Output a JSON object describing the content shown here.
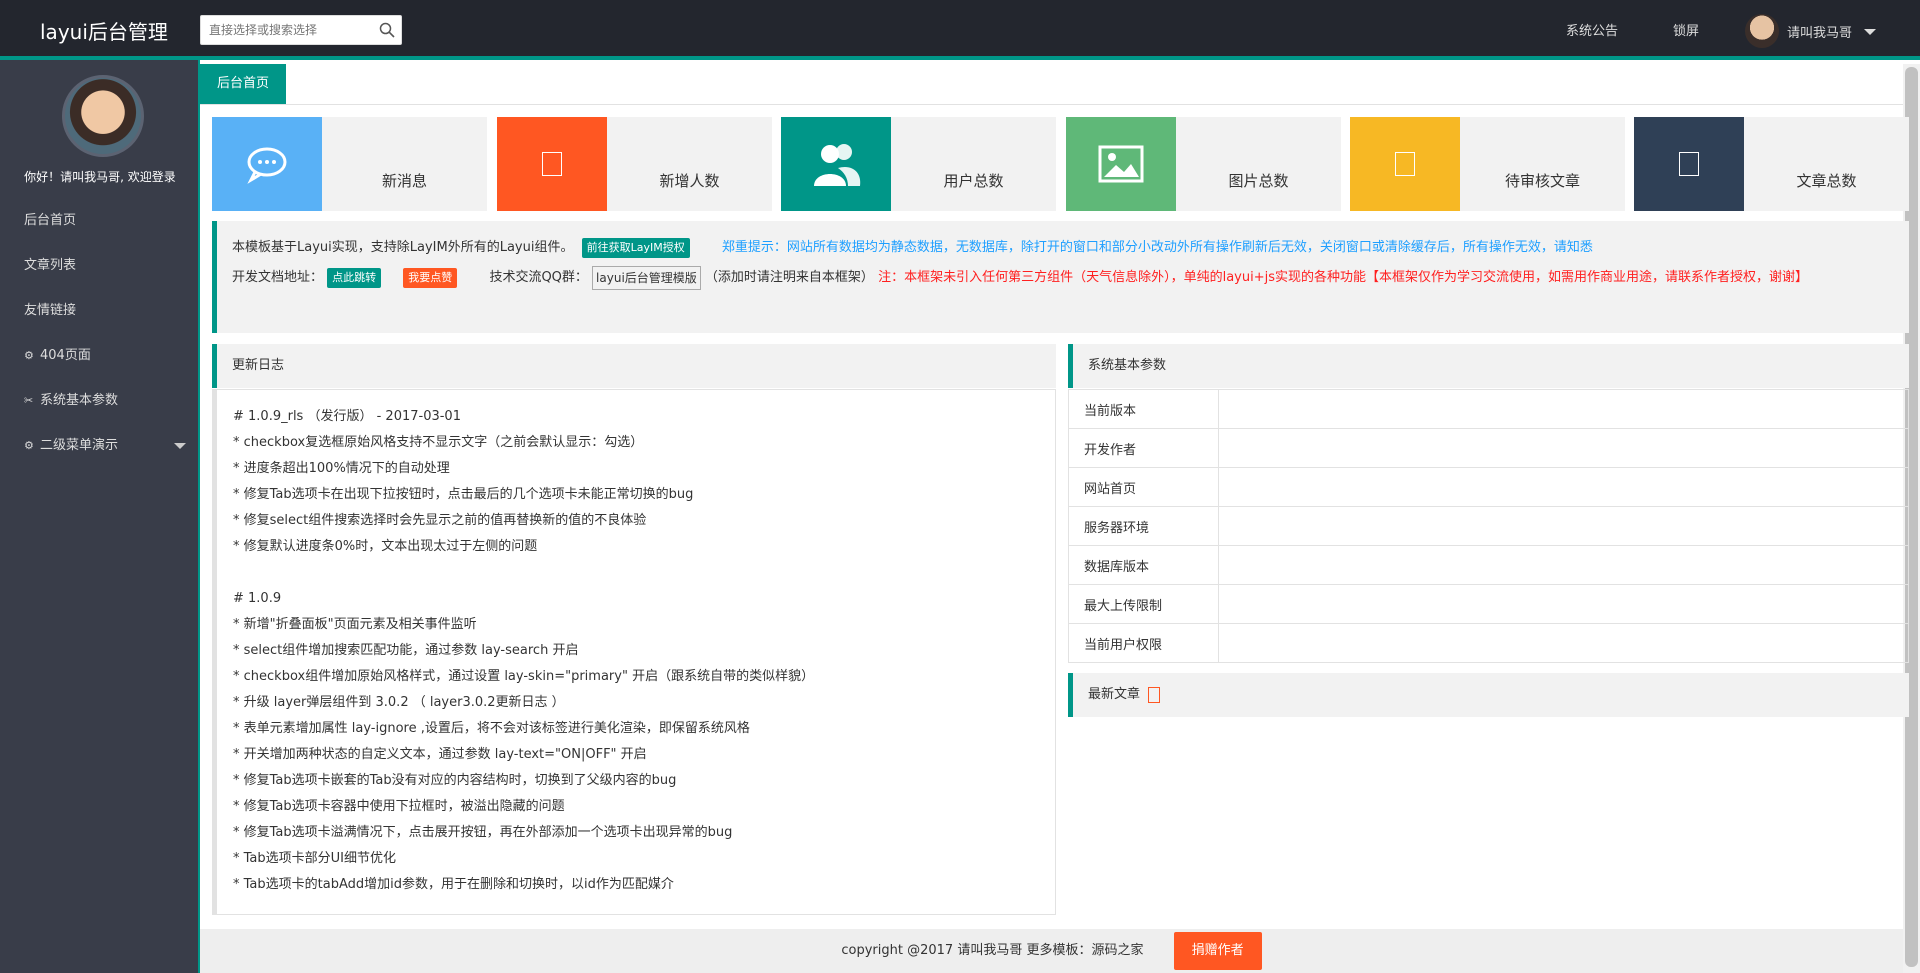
{
  "header": {
    "logo": "layui后台管理",
    "search_placeholder": "直接选择或搜索选择",
    "nav": [
      "系统公告",
      "锁屏"
    ],
    "username": "请叫我马哥"
  },
  "sidebar": {
    "welcome": "你好！请叫我马哥, 欢迎登录",
    "items": [
      {
        "label": "后台首页",
        "icon": ""
      },
      {
        "label": "文章列表",
        "icon": ""
      },
      {
        "label": "友情链接",
        "icon": ""
      },
      {
        "label": "404页面",
        "icon": "robot-icon"
      },
      {
        "label": "系统基本参数",
        "icon": "wrench-icon"
      },
      {
        "label": "二级菜单演示",
        "icon": "robot-icon"
      }
    ]
  },
  "tabs": {
    "active": "后台首页"
  },
  "stats": [
    {
      "label": "新消息",
      "color": "#59b1f6",
      "icon": "message-icon"
    },
    {
      "label": "新增人数",
      "color": "#ff5722",
      "icon": "placeholder-icon"
    },
    {
      "label": "用户总数",
      "color": "#009688",
      "icon": "users-icon"
    },
    {
      "label": "图片总数",
      "color": "#5fb878",
      "icon": "image-icon"
    },
    {
      "label": "待审核文章",
      "color": "#f7b824",
      "icon": "placeholder-icon"
    },
    {
      "label": "文章总数",
      "color": "#2f4056",
      "icon": "placeholder-icon"
    }
  ],
  "notice": {
    "line1_text": "本模板基于Layui实现，支持除LayIM外所有的Layui组件。",
    "line1_button": "前往获取LayIM授权",
    "line1_blue": "郑重提示：网站所有数据均为静态数据，无数据库，除打开的窗口和部分小改动外所有操作刷新后无效，关闭窗口或清除缓存后，所有操作无效，请知悉",
    "doc_label": "开发文档地址：",
    "doc_button": "点此跳转",
    "like_button": "我要点赞",
    "qq_label": "技术交流QQ群：",
    "qq_img_alt": "layui后台管理模版",
    "qq_note": "（添加时请注明来自本框架）",
    "red": "注：本框架未引入任何第三方组件（天气信息除外），单纯的layui+js实现的各种功能【本框架仅作为学习交流使用，如需用作商业用途，请联系作者授权，谢谢】"
  },
  "changelog": {
    "title": "更新日志",
    "lines": [
      "# 1.0.9_rls （发行版） - 2017-03-01",
      "* checkbox复选框原始风格支持不显示文字（之前会默认显示：勾选）",
      "* 进度条超出100%情况下的自动处理",
      "* 修复Tab选项卡在出现下拉按钮时，点击最后的几个选项卡未能正常切换的bug",
      "* 修复select组件搜索选择时会先显示之前的值再替换新的值的不良体验",
      "* 修复默认进度条0%时，文本出现太过于左侧的问题",
      "",
      "# 1.0.9",
      "* 新增\"折叠面板\"页面元素及相关事件监听",
      "* select组件增加搜索匹配功能，通过参数 lay-search 开启",
      "* checkbox组件增加原始风格样式，通过设置 lay-skin=\"primary\" 开启（跟系统自带的类似样貌）",
      "* 升级 layer弹层组件到 3.0.2 （ layer3.0.2更新日志 ）",
      "* 表单元素增加属性 lay-ignore ,设置后，将不会对该标签进行美化渲染，即保留系统风格",
      "* 开关增加两种状态的自定义文本，通过参数 lay-text=\"ON|OFF\" 开启",
      "* 修复Tab选项卡嵌套的Tab没有对应的内容结构时，切换到了父级内容的bug",
      "* 修复Tab选项卡容器中使用下拉框时，被溢出隐藏的问题",
      "* 修复Tab选项卡溢满情况下，点击展开按钮，再在外部添加一个选项卡出现异常的bug",
      "* Tab选项卡部分UI细节优化",
      "* Tab选项卡的tabAdd增加id参数，用于在删除和切换时，以id作为匹配媒介"
    ]
  },
  "params": {
    "title": "系统基本参数",
    "rows": [
      "当前版本",
      "开发作者",
      "网站首页",
      "服务器环境",
      "数据库版本",
      "最大上传限制",
      "当前用户权限"
    ]
  },
  "newest": {
    "title": "最新文章"
  },
  "footer": {
    "text": "copyright @2017 请叫我马哥 更多模板：源码之家",
    "donate": "捐赠作者"
  }
}
